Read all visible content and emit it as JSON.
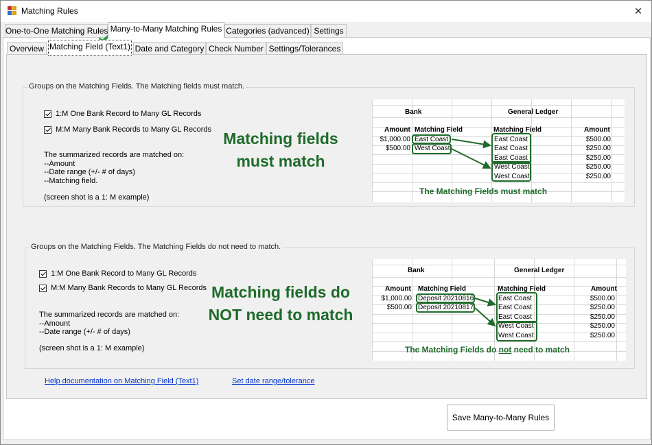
{
  "window": {
    "title": "Matching Rules",
    "close_glyph": "✕"
  },
  "outer_tabs": [
    "One-to-One Matching Rules",
    "Many-to-Many Matching Rules",
    "Categories (advanced)",
    "Settings"
  ],
  "inner_tabs": [
    "Overview",
    "Matching Field (Text1)",
    "Date and Category",
    "Check Number",
    "Settings/Tolerances"
  ],
  "group1": {
    "legend": "Groups on the Matching Fields. The Matching fields must match.",
    "checkbox1": "1:M One Bank Record to Many GL Records",
    "checkbox2": "M:M Many Bank Records to Many GL Records",
    "notes": [
      "The summarized records are matched on:",
      "--Amount",
      "--Date range (+/- # of days)",
      "--Matching field."
    ],
    "example_note": "(screen shot is a 1: M example)",
    "big_label_line1": "Matching fields",
    "big_label_line2": "must match",
    "sheet": {
      "bank_header": "Bank",
      "gl_header": "General Ledger",
      "col_amount": "Amount",
      "col_matching_field": "Matching Field",
      "col_gl_matching_field": "Matching Field",
      "col_gl_amount": "Amount",
      "bank_rows": [
        {
          "amount": "$1,000.00",
          "field": "East Coast"
        },
        {
          "amount": "$500.00",
          "field": "West Coast"
        }
      ],
      "gl_rows": [
        {
          "field": "East Coast",
          "amount": "$500.00"
        },
        {
          "field": "East Coast",
          "amount": "$250.00"
        },
        {
          "field": "East Coast",
          "amount": "$250.00"
        },
        {
          "field": "West Coast",
          "amount": "$250.00"
        },
        {
          "field": "West Coast",
          "amount": "$250.00"
        }
      ],
      "caption": "The Matching Fields must match"
    }
  },
  "group2": {
    "legend": "Groups on the Matching Fields.  The Matching Fields do not need to match.",
    "checkbox1": "1:M One Bank Record to Many GL Records",
    "checkbox2": "M:M Many Bank Records to Many GL Records",
    "notes": [
      "The summarized records are matched on:",
      "--Amount",
      "--Date range (+/- # of days)"
    ],
    "example_note": "(screen shot is a 1: M example)",
    "big_label_line1": "Matching fields do",
    "big_label_line2": "NOT need to match",
    "sheet": {
      "bank_header": "Bank",
      "gl_header": "General Ledger",
      "col_amount": "Amount",
      "col_matching_field": "Matching Field",
      "col_gl_matching_field": "Matching Field",
      "col_gl_amount": "Amount",
      "bank_rows": [
        {
          "amount": "$1,000.00",
          "field": "Deposit 20210816"
        },
        {
          "amount": "$500.00",
          "field": "Deposit 20210817"
        }
      ],
      "gl_rows": [
        {
          "field": "East Coast",
          "amount": "$500.00"
        },
        {
          "field": "East Coast",
          "amount": "$250.00"
        },
        {
          "field": "East Coast",
          "amount": "$250.00"
        },
        {
          "field": "West Coast",
          "amount": "$250.00"
        },
        {
          "field": "West Coast",
          "amount": "$250.00"
        }
      ],
      "caption_part1": "The Matching Fields do ",
      "caption_part2": "not",
      "caption_part3": " need to match"
    }
  },
  "links": {
    "help": "Help documentation on Matching Field (Text1)",
    "date_range": "Set date range/tolerance"
  },
  "save_button": "Save Many-to-Many Rules",
  "colors": {
    "accent_green": "#1e6b2a",
    "link_blue": "#0033cc"
  },
  "icons": {
    "app": "matching-rules-app-icon",
    "pointer": "green-arrow-icon"
  }
}
